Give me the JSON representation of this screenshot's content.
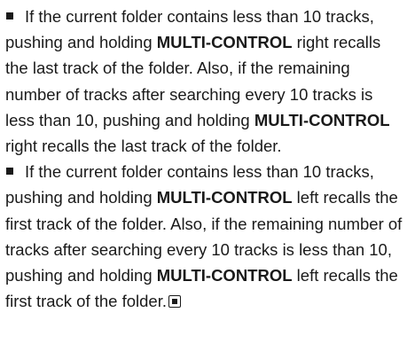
{
  "paragraphs": [
    {
      "t1": "If the current folder contains less than 10 tracks, pushing and holding ",
      "k1": "MULTI-CONTROL",
      "t2": " right recalls the last track of the folder. Also, if the remaining number of tracks after searching every 10 tracks is less than 10, pushing and holding ",
      "k2": "MULTI-CONTROL",
      "t3": " right recalls the last track of the folder."
    },
    {
      "t1": "If the current folder contains less than 10 tracks, pushing and holding ",
      "k1": "MULTI-CONTROL",
      "t2": " left recalls the first track of the folder. Also, if the remaining number of tracks after searching every 10 tracks is less than 10, pushing and holding ",
      "k2": "MULTI-CONTROL",
      "t3": " left recalls the first track of the folder."
    }
  ],
  "icons": {
    "bullet": "square-bullet-icon",
    "end_mark": "end-of-section-icon"
  }
}
